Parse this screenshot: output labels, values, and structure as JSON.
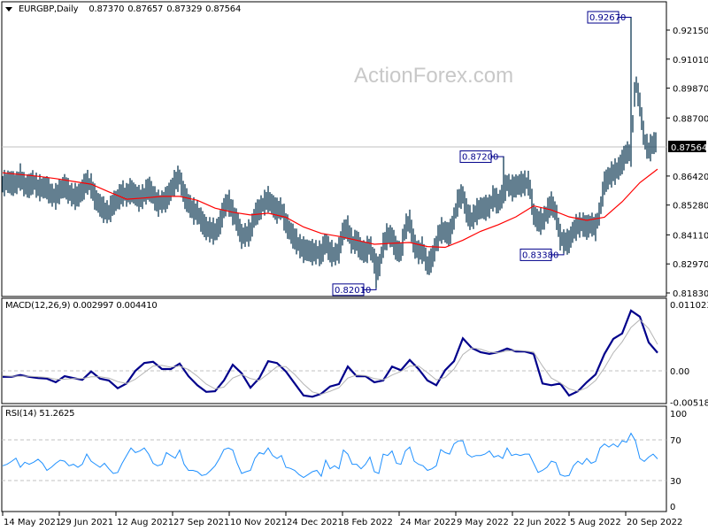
{
  "header": {
    "symbol": "EURGBP,Daily",
    "open": "0.87370",
    "high": "0.87657",
    "low": "0.87329",
    "close": "0.87564"
  },
  "watermark": "ActionForex.com",
  "colors": {
    "bars": "#0f3a55",
    "ma": "#ff0000",
    "macd": "#00008b",
    "signal": "#b4b4b4",
    "rsi": "#1e90ff",
    "grid": "#c0c0c0",
    "price_line": "#c0c0c0"
  },
  "chart_data": [
    {
      "type": "bar",
      "title": "EURGBP,Daily",
      "subtype": "ohlc",
      "bar_count": 370,
      "mid_sample_step_bars": 2.5,
      "mid_prices": [
        0.861,
        0.8621,
        0.8614,
        0.861,
        0.8638,
        0.8603,
        0.8603,
        0.8621,
        0.8596,
        0.8596,
        0.8596,
        0.8568,
        0.8562,
        0.8586,
        0.8603,
        0.8579,
        0.8562,
        0.8562,
        0.8586,
        0.8621,
        0.8603,
        0.8551,
        0.8527,
        0.8506,
        0.8499,
        0.8534,
        0.8551,
        0.8575,
        0.8568,
        0.8586,
        0.8568,
        0.8551,
        0.8568,
        0.8596,
        0.8568,
        0.8534,
        0.8541,
        0.8551,
        0.8586,
        0.8621,
        0.8638,
        0.8568,
        0.8534,
        0.8506,
        0.8499,
        0.8464,
        0.8436,
        0.843,
        0.8423,
        0.8447,
        0.8516,
        0.8544,
        0.8499,
        0.8464,
        0.8405,
        0.8412,
        0.8423,
        0.8489,
        0.8509,
        0.8534,
        0.8551,
        0.8527,
        0.8506,
        0.8516,
        0.8457,
        0.8423,
        0.8395,
        0.837,
        0.8353,
        0.835,
        0.8343,
        0.8343,
        0.8336,
        0.8384,
        0.8343,
        0.8332,
        0.835,
        0.843,
        0.8436,
        0.8377,
        0.8388,
        0.835,
        0.8343,
        0.837,
        0.8308,
        0.8273,
        0.837,
        0.8412,
        0.8402,
        0.835,
        0.8343,
        0.844,
        0.8464,
        0.837,
        0.8343,
        0.8353,
        0.8291,
        0.8315,
        0.8377,
        0.843,
        0.8423,
        0.8412,
        0.8475,
        0.8551,
        0.8568,
        0.8492,
        0.8471,
        0.8499,
        0.8516,
        0.8516,
        0.8523,
        0.8562,
        0.8534,
        0.8568,
        0.8614,
        0.8593,
        0.8603,
        0.861,
        0.8614,
        0.8614,
        0.8492,
        0.8464,
        0.8464,
        0.8499,
        0.8534,
        0.8499,
        0.8402,
        0.8384,
        0.8384,
        0.843,
        0.8447,
        0.8454,
        0.844,
        0.8454,
        0.844,
        0.8506,
        0.8614,
        0.8638,
        0.8655,
        0.8666,
        0.8697,
        0.8735,
        0.8732,
        0.902,
        0.8923,
        0.8784,
        0.8742,
        0.877,
        0.8777
      ],
      "ma_sample_step_bars": 10,
      "ma_prices": [
        0.8655,
        0.8648,
        0.8641,
        0.8632,
        0.8621,
        0.861,
        0.858,
        0.8551,
        0.8556,
        0.8562,
        0.8562,
        0.8547,
        0.8516,
        0.85,
        0.8489,
        0.8496,
        0.848,
        0.8442,
        0.8417,
        0.8405,
        0.839,
        0.8374,
        0.8378,
        0.8381,
        0.8365,
        0.8362,
        0.839,
        0.8425,
        0.8451,
        0.8482,
        0.8525,
        0.8509,
        0.8482,
        0.8468,
        0.848,
        0.8541,
        0.8616,
        0.8669
      ],
      "current_price": 0.87564,
      "current_price_label": "0.87564",
      "ylim": [
        0.8155,
        0.933
      ],
      "y_ticks": [
        "0.92150",
        "0.91010",
        "0.89870",
        "0.88700",
        "0.86420",
        "0.85280",
        "0.84110",
        "0.82970",
        "0.81830"
      ],
      "annotations": [
        {
          "label": "0.92670",
          "price": 0.9267,
          "bar": 355,
          "kind": "high",
          "side": "left"
        },
        {
          "label": "0.87200",
          "price": 0.872,
          "bar": 283,
          "kind": "high",
          "side": "left"
        },
        {
          "label": "0.83380",
          "price": 0.8338,
          "bar": 317,
          "kind": "low",
          "side": "left"
        },
        {
          "label": "0.82010",
          "price": 0.8201,
          "bar": 211,
          "kind": "low",
          "side": "left"
        }
      ],
      "x_ticks": [
        {
          "label": "14 May 2021",
          "bar": 0
        },
        {
          "label": "29 Jun 2021",
          "bar": 32
        },
        {
          "label": "12 Aug 2021",
          "bar": 64
        },
        {
          "label": "27 Sep 2021",
          "bar": 96
        },
        {
          "label": "10 Nov 2021",
          "bar": 128
        },
        {
          "label": "24 Dec 2021",
          "bar": 160
        },
        {
          "label": "8 Feb 2022",
          "bar": 192
        },
        {
          "label": "24 Mar 2022",
          "bar": 224
        },
        {
          "label": "9 May 2022",
          "bar": 256
        },
        {
          "label": "22 Jun 2022",
          "bar": 288
        },
        {
          "label": "5 Aug 2022",
          "bar": 320
        },
        {
          "label": "20 Sep 2022",
          "bar": 352
        }
      ]
    },
    {
      "type": "line",
      "title": "MACD(12,26,9) 0.002997 0.004410",
      "sample_step_bars": 5,
      "ylim": [
        -0.005182,
        0.011023
      ],
      "y_ticks": [
        "0.011023",
        "0.00",
        "-0.005182"
      ],
      "series": [
        {
          "name": "MACD",
          "values": [
            -0.001,
            -0.001,
            -0.0007,
            -0.001,
            -0.0012,
            -0.0013,
            -0.0019,
            -0.0009,
            -0.0012,
            -0.0015,
            -0.0001,
            -0.0013,
            -0.0016,
            -0.0029,
            -0.0021,
            0.0,
            0.0013,
            0.0015,
            0.0003,
            0.0003,
            0.0012,
            -0.0009,
            -0.0024,
            -0.0035,
            -0.0034,
            -0.0016,
            0.001,
            -0.0004,
            -0.0028,
            -0.0012,
            0.0016,
            0.0013,
            -0.0001,
            -0.0021,
            -0.0041,
            -0.0043,
            -0.0038,
            -0.0026,
            -0.0022,
            0.0007,
            -0.0009,
            -0.0009,
            -0.0019,
            -0.0016,
            0.0007,
            0.0001,
            0.0018,
            0.0003,
            -0.0016,
            -0.0024,
            0.0001,
            0.0016,
            0.0054,
            0.0038,
            0.0031,
            0.0028,
            0.0031,
            0.0037,
            0.0032,
            0.0032,
            0.0028,
            -0.0021,
            -0.0024,
            -0.0021,
            -0.0041,
            -0.0034,
            -0.0019,
            -0.0006,
            0.0028,
            0.0053,
            0.0062,
            0.01,
            0.009,
            0.0047,
            0.003
          ]
        },
        {
          "name": "Signal",
          "values": [
            -0.0008,
            -0.0009,
            -0.0009,
            -0.0009,
            -0.001,
            -0.0011,
            -0.0014,
            -0.0014,
            -0.0013,
            -0.0013,
            -0.001,
            -0.001,
            -0.0012,
            -0.0018,
            -0.0021,
            -0.0014,
            -0.0003,
            0.0008,
            0.0009,
            0.0006,
            0.0008,
            0.0002,
            -0.0009,
            -0.0022,
            -0.003,
            -0.0027,
            -0.0012,
            -0.0006,
            -0.0013,
            -0.0016,
            -0.0005,
            0.0007,
            0.0007,
            -0.0006,
            -0.0022,
            -0.0035,
            -0.0039,
            -0.0034,
            -0.0028,
            -0.0012,
            -0.0007,
            -0.0008,
            -0.0013,
            -0.0015,
            -0.0007,
            -0.0001,
            0.0008,
            0.0008,
            -0.0003,
            -0.0015,
            -0.0011,
            0.0003,
            0.0027,
            0.0038,
            0.0036,
            0.0031,
            0.003,
            0.0033,
            0.0034,
            0.0033,
            0.0031,
            0.0008,
            -0.0012,
            -0.002,
            -0.003,
            -0.0034,
            -0.0028,
            -0.0016,
            0.0005,
            0.003,
            0.0048,
            0.0072,
            0.0085,
            0.007,
            0.0044
          ]
        }
      ]
    },
    {
      "type": "line",
      "title": "RSI(14) 51.2625",
      "sample_step_bars": 2.5,
      "ylim": [
        0,
        100
      ],
      "y_ticks": [
        "100",
        "70",
        "30",
        "0"
      ],
      "levels": [
        70,
        30
      ],
      "series": [
        {
          "name": "RSI",
          "values": [
            44.5,
            46,
            48.8,
            52,
            43,
            48,
            46,
            48,
            51,
            47,
            40,
            43,
            47,
            50,
            49,
            44.5,
            46,
            43,
            46,
            56,
            49,
            46,
            43,
            47,
            41.6,
            37,
            38,
            47,
            54.6,
            62,
            57.5,
            59,
            62,
            56,
            47,
            44.5,
            46,
            57.5,
            54.6,
            52,
            60,
            46,
            40,
            40,
            38.7,
            35,
            36,
            40,
            44.5,
            51.7,
            60.4,
            62,
            60,
            47,
            37,
            38.7,
            40,
            51.7,
            57.5,
            56,
            62,
            54.6,
            51.7,
            54.6,
            43,
            42,
            40,
            35.8,
            33,
            35.8,
            38.7,
            40,
            34.3,
            50,
            41.6,
            44.5,
            41.6,
            60,
            56,
            46,
            46,
            41.6,
            46,
            53,
            38.7,
            37,
            56,
            54.6,
            59,
            47,
            46,
            59,
            63,
            49,
            46,
            44.5,
            40,
            41.6,
            44.5,
            60.4,
            57.5,
            56,
            66,
            69,
            69,
            56,
            53,
            54.6,
            54.6,
            56,
            59,
            53,
            54.6,
            51.7,
            62,
            54.6,
            56,
            54.6,
            56,
            56,
            47,
            38,
            40,
            43,
            49,
            47.7,
            35.8,
            34.3,
            35,
            44.5,
            49,
            46,
            51.7,
            47,
            48.8,
            62,
            66,
            63,
            66,
            63,
            69,
            67.7,
            76.4,
            69,
            51.7,
            48.8,
            53,
            56,
            51.3
          ]
        }
      ]
    }
  ]
}
